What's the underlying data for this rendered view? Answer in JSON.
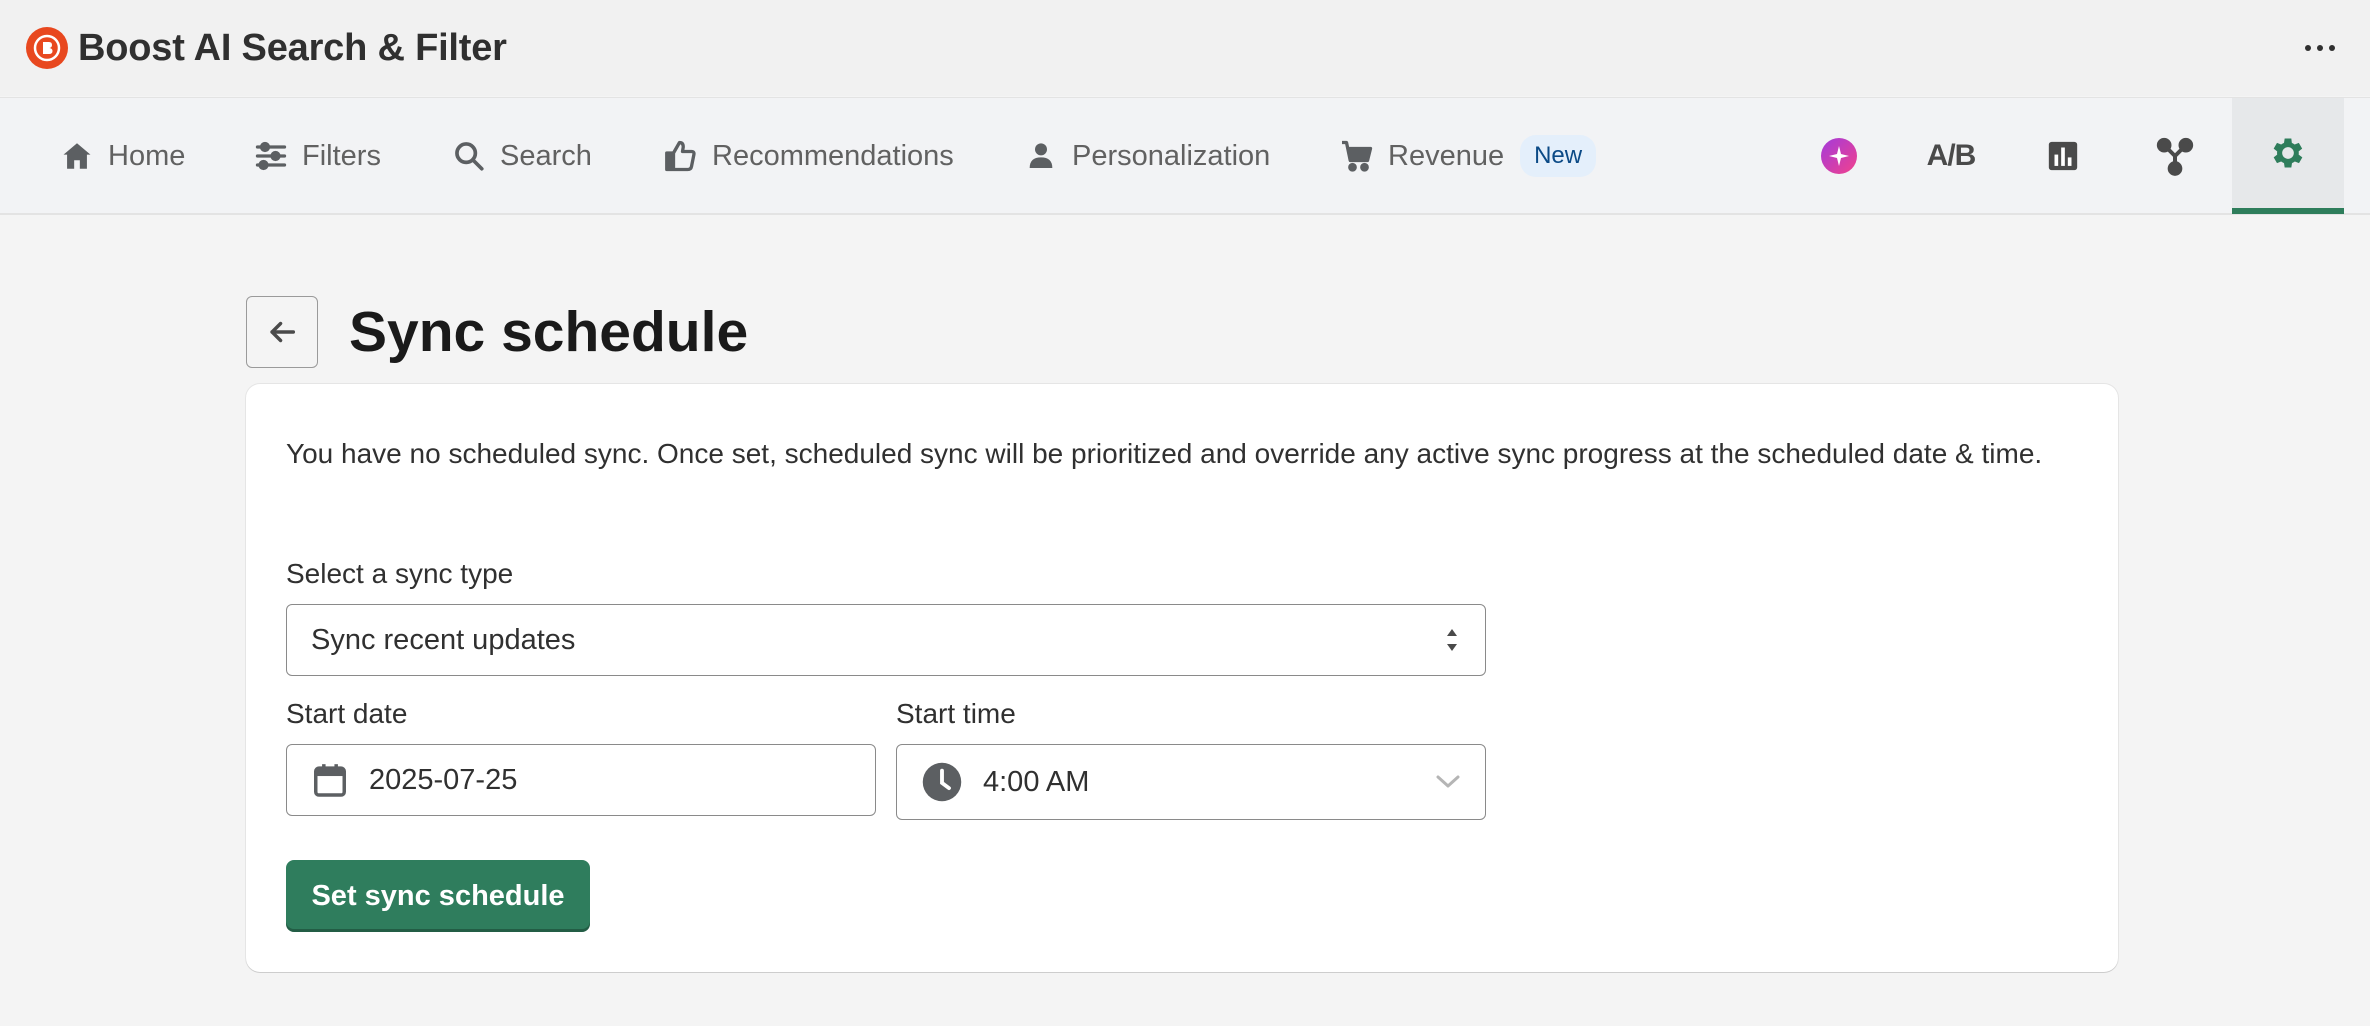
{
  "app": {
    "title": "Boost AI Search & Filter",
    "logo_icon": "boost-logo-icon",
    "more_icon": "ellipsis-icon"
  },
  "nav": {
    "items": [
      {
        "label": "Home",
        "icon": "home-icon"
      },
      {
        "label": "Filters",
        "icon": "sliders-icon"
      },
      {
        "label": "Search",
        "icon": "search-icon"
      },
      {
        "label": "Recommendations",
        "icon": "thumbs-up-icon"
      },
      {
        "label": "Personalization",
        "icon": "person-icon"
      },
      {
        "label": "Revenue",
        "icon": "cart-icon",
        "badge": "New"
      }
    ],
    "icon_tabs": [
      {
        "icon": "ai-sparkle-icon"
      },
      {
        "icon": "ab-test-icon",
        "text": "A/B"
      },
      {
        "icon": "bar-chart-icon"
      },
      {
        "icon": "integrations-icon"
      },
      {
        "icon": "gear-icon",
        "active": true
      }
    ]
  },
  "page": {
    "title": "Sync schedule",
    "back_icon": "arrow-left-icon"
  },
  "form": {
    "info": "You have no scheduled sync. Once set, scheduled sync will be prioritized and override any active sync progress at the scheduled date & time.",
    "sync_type_label": "Select a sync type",
    "sync_type_value": "Sync recent updates",
    "start_date_label": "Start date",
    "start_date_value": "2025-07-25",
    "start_time_label": "Start time",
    "start_time_value": "4:00 AM",
    "submit_label": "Set sync schedule"
  },
  "colors": {
    "accent": "#2f7d5d",
    "brand": "#e8481f",
    "badge_bg": "#e4effb",
    "badge_text": "#0b4a86"
  }
}
